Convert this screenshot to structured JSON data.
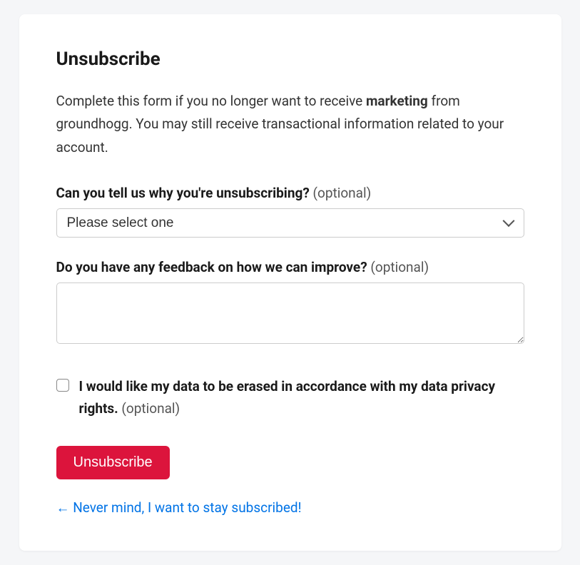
{
  "title": "Unsubscribe",
  "intro": {
    "pre": "Complete this form if you no longer want to receive ",
    "bold": "marketing",
    "post": " from groundhogg. You may still receive transactional information related to your account."
  },
  "reason": {
    "label": "Can you tell us why you're unsubscribing?",
    "optional": " (optional)",
    "placeholder": "Please select one"
  },
  "feedback": {
    "label": "Do you have any feedback on how we can improve?",
    "optional": " (optional)"
  },
  "erase": {
    "text": "I would like my data to be erased in accordance with my data privacy rights.",
    "optional": " (optional)"
  },
  "button": "Unsubscribe",
  "back": "← Never mind, I want to stay subscribed!"
}
